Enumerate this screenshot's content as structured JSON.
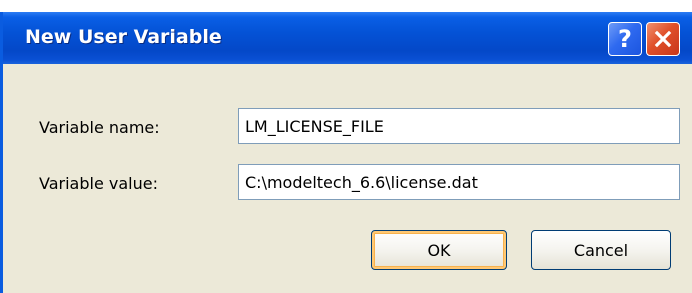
{
  "window": {
    "title": "New User Variable",
    "help_icon_glyph": "?",
    "titlebar_color": "#0a52d6",
    "close_color": "#e0502a"
  },
  "background_text": "~ ~~~~~~~~ ~~~~ ",
  "form": {
    "name_label": "Variable name:",
    "name_value": "LM_LICENSE_FILE",
    "value_label": "Variable value:",
    "value_value": "C:\\modeltech_6.6\\license.dat"
  },
  "buttons": {
    "ok_label": "OK",
    "cancel_label": "Cancel"
  }
}
